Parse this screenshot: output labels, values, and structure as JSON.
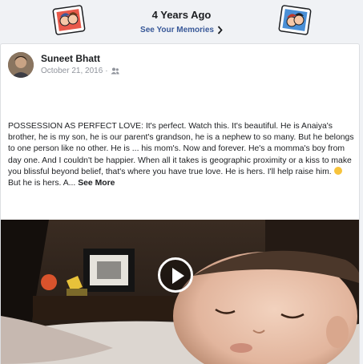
{
  "memories_header": {
    "title": "4 Years Ago",
    "link_label": "See Your Memories",
    "chevron_icon": "chevron-right-icon"
  },
  "post": {
    "author": "Suneet Bhatt",
    "date": "October 21, 2016",
    "separator": "·",
    "audience_icon": "friends-icon",
    "text": "POSSESSION AS PERFECT LOVE: It's perfect. Watch this. It's beautiful. He is Anaiya's brother, he is my son, he is our parent's grandson, he is a nephew to so many. But he belongs to one person like no other. He is ... his mom's. Now and forever. He's a momma's boy from day one. And I couldn't be happier. When all it takes is geographic proximity or a kiss to make you blissful beyond belief, that's where you have true love. He is hers. I'll help raise him.",
    "text_after_emoji": " But he is hers. A...",
    "emoji": "winking-face",
    "see_more": "See More",
    "video_play_icon": "play-icon"
  },
  "colors": {
    "link": "#385898",
    "background": "#f0f2f5",
    "card": "#ffffff"
  }
}
